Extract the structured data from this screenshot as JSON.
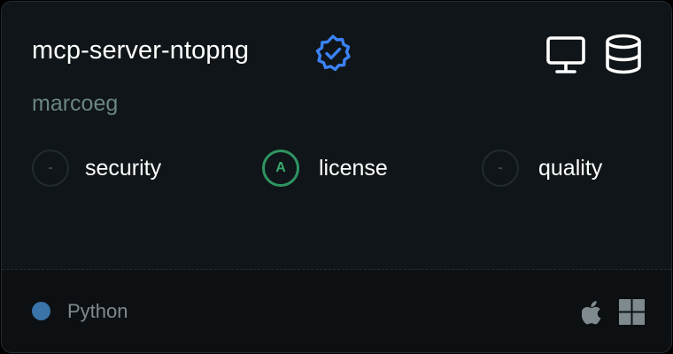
{
  "card": {
    "title": "mcp-server-ntopng",
    "author": "marcoeg",
    "header_icons": [
      "verified-badge-icon",
      "monitor-icon",
      "database-icon"
    ],
    "scores": [
      {
        "label": "security",
        "grade": "-"
      },
      {
        "label": "license",
        "grade": "A"
      },
      {
        "label": "quality",
        "grade": "-"
      }
    ],
    "footer": {
      "language": "Python",
      "language_color": "#3b74a8",
      "platform_icons": [
        "apple-icon",
        "windows-icon"
      ]
    }
  },
  "colors": {
    "background": "#0f1518",
    "footer_background": "#0c1013",
    "verified_blue": "#3b82f6",
    "grade_a_green": "#2f9461",
    "author_text": "#6b8583"
  }
}
